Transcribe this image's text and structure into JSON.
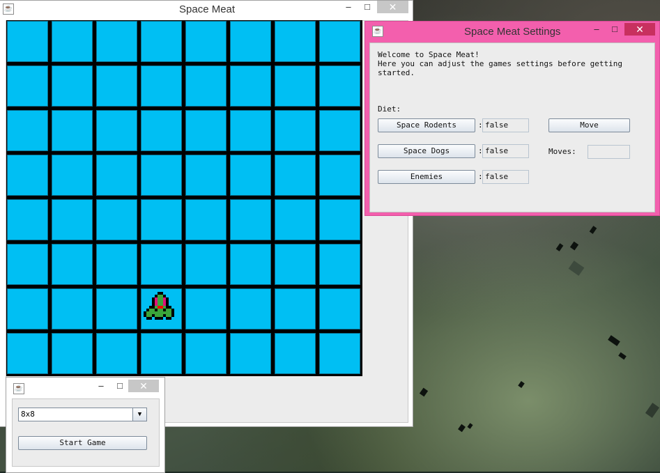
{
  "game_window": {
    "title": "Space Meat",
    "grid": {
      "rows": 8,
      "cols": 8,
      "ship_row": 6,
      "ship_col": 3
    },
    "colors": {
      "cell": "#00bff3",
      "grid_line": "#000000",
      "ship_green": "#3aa53a",
      "ship_pink": "#e0107a",
      "ship_red": "#ff0000"
    }
  },
  "settings_window": {
    "title": "Space Meat Settings",
    "welcome_line1": "Welcome to Space Meat!",
    "welcome_line2": "Here you can adjust the games settings before getting",
    "welcome_line3": "started.",
    "diet_label": "Diet:",
    "rows": [
      {
        "button": "Space Rodents",
        "sep": ":",
        "value": "false"
      },
      {
        "button": "Space Dogs",
        "sep": ":",
        "value": "false"
      },
      {
        "button": "Enemies",
        "sep": ":",
        "value": "false"
      }
    ],
    "move_button": "Move",
    "moves_label": "Moves:",
    "moves_value": "",
    "accent_color": "#f35fad"
  },
  "launcher_window": {
    "grid_size_selected": "8x8",
    "start_button": "Start Game"
  },
  "icons": {
    "window_icon": "java-icon",
    "minimize": "minimize-icon",
    "maximize": "maximize-icon",
    "close": "close-icon",
    "dropdown": "chevron-down-icon"
  }
}
